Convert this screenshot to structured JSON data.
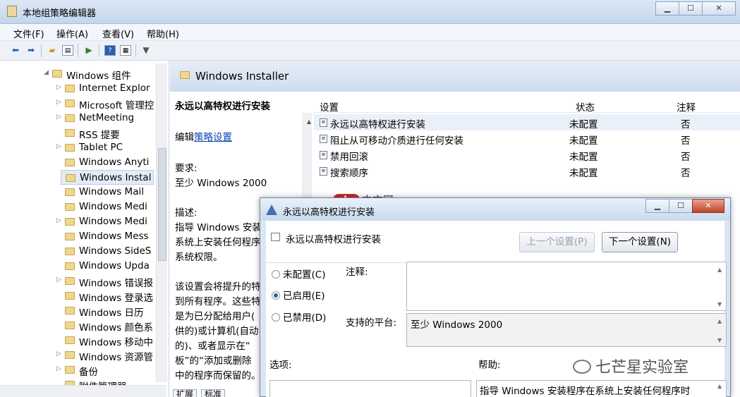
{
  "window": {
    "title": "本地组策略编辑器"
  },
  "menu": [
    "文件(F)",
    "操作(A)",
    "查看(V)",
    "帮助(H)"
  ],
  "tree": [
    {
      "label": "Windows 组件",
      "arrow": "◢",
      "level": 0
    },
    {
      "label": "Internet Explor",
      "arrow": "▷",
      "level": 1
    },
    {
      "label": "Microsoft 管理控",
      "arrow": "▷",
      "level": 1
    },
    {
      "label": "NetMeeting",
      "arrow": "▷",
      "level": 1
    },
    {
      "label": "RSS 提要",
      "arrow": "",
      "level": 1
    },
    {
      "label": "Tablet PC",
      "arrow": "▷",
      "level": 1
    },
    {
      "label": "Windows Anyti",
      "arrow": "",
      "level": 1
    },
    {
      "label": "Windows Instal",
      "arrow": "",
      "level": 1,
      "selected": true
    },
    {
      "label": "Windows Mail",
      "arrow": "",
      "level": 1
    },
    {
      "label": "Windows Medi",
      "arrow": "",
      "level": 1
    },
    {
      "label": "Windows Medi",
      "arrow": "▷",
      "level": 1
    },
    {
      "label": "Windows Mess",
      "arrow": "",
      "level": 1
    },
    {
      "label": "Windows SideS",
      "arrow": "",
      "level": 1
    },
    {
      "label": "Windows Upda",
      "arrow": "",
      "level": 1
    },
    {
      "label": "Windows 错误报",
      "arrow": "▷",
      "level": 1
    },
    {
      "label": "Windows 登录选",
      "arrow": "",
      "level": 1
    },
    {
      "label": "Windows 日历",
      "arrow": "",
      "level": 1
    },
    {
      "label": "Windows 颜色系",
      "arrow": "",
      "level": 1
    },
    {
      "label": "Windows 移动中",
      "arrow": "",
      "level": 1
    },
    {
      "label": "Windows 资源管",
      "arrow": "▷",
      "level": 1
    },
    {
      "label": "备份",
      "arrow": "▷",
      "level": 1
    },
    {
      "label": "附件管理器",
      "arrow": "",
      "level": 1
    }
  ],
  "pane": {
    "title": "Windows Installer"
  },
  "description": {
    "heading": "永远以高特权进行安装",
    "edit_prefix": "编辑",
    "edit_link": "策略设置",
    "req_label": "要求:",
    "req_value": "至少 Windows 2000",
    "desc_label": "描述:",
    "lines": [
      "指导 Windows 安装",
      "系统上安装任何程序",
      "系统权限。",
      "",
      "该设置会将提升的特",
      "到所有程序。这些特",
      "是为已分配给用户(",
      "供的)或计算机(自动",
      "的)、或者显示在“",
      "板”的“添加或删除",
      "中的程序而保留的。"
    ]
  },
  "list": {
    "headers": {
      "setting": "设置",
      "state": "状态",
      "comment": "注释"
    },
    "rows": [
      {
        "setting": "永远以高特权进行安装",
        "state": "未配置",
        "comment": "否"
      },
      {
        "setting": "阻止从可移动介质进行任何安装",
        "state": "未配置",
        "comment": "否"
      },
      {
        "setting": "禁用回滚",
        "state": "未配置",
        "comment": "否"
      },
      {
        "setting": "搜索顺序",
        "state": "未配置",
        "comment": "否"
      }
    ]
  },
  "tabs": [
    "扩展",
    "标准"
  ],
  "watermark": {
    "php": "php",
    "cn": "中文网"
  },
  "dialog": {
    "title": "永远以高特权进行安装",
    "setting_name": "永远以高特权进行安装",
    "prev_button": "上一个设置(P)",
    "next_button": "下一个设置(N)",
    "radios": [
      {
        "label": "未配置(C)",
        "checked": false
      },
      {
        "label": "已启用(E)",
        "checked": true
      },
      {
        "label": "已禁用(D)",
        "checked": false
      }
    ],
    "comment_label": "注释:",
    "platform_label": "支持的平台:",
    "platform_value": "至少 Windows 2000",
    "options_label": "选项:",
    "help_label": "帮助:",
    "help_text": "指导 Windows 安装程序在系统上安装任何程序时"
  },
  "wechat": {
    "label": "七芒星实验室"
  }
}
